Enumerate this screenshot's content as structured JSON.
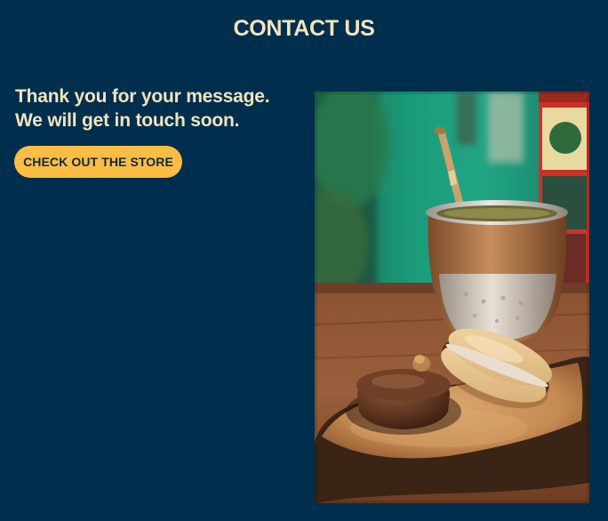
{
  "page": {
    "title": "CONTACT US"
  },
  "confirmation": {
    "line1": "Thank you for your message.",
    "line2": "We will get in touch soon."
  },
  "cta": {
    "label": "CHECK OUT THE STORE"
  },
  "colors": {
    "background": "#002e4d",
    "heading_text": "#f1e4bd",
    "button_background": "#fbbd44",
    "button_text": "#102a3f"
  }
}
